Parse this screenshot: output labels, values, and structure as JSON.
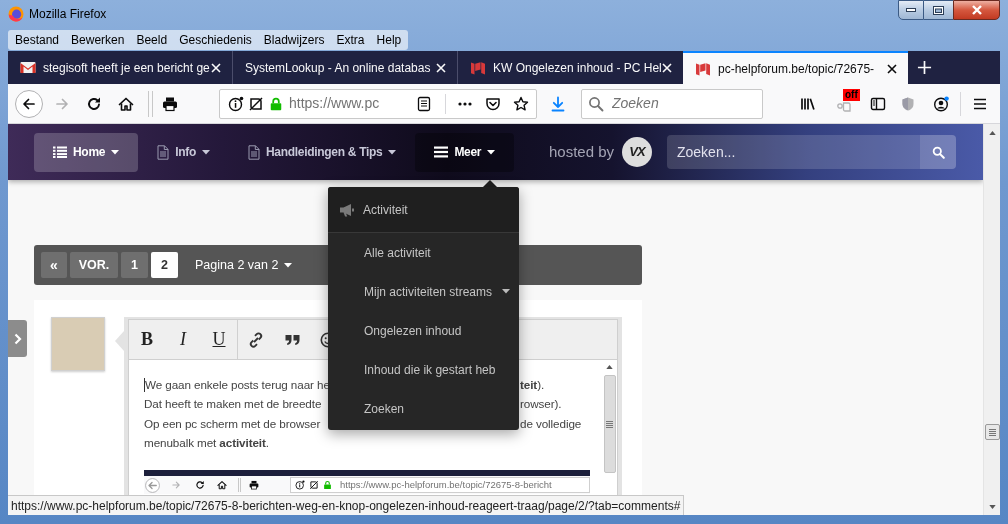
{
  "window": {
    "title": "Mozilla Firefox"
  },
  "menu_bar": [
    "Bestand",
    "Bewerken",
    "Beeld",
    "Geschiedenis",
    "Bladwijzers",
    "Extra",
    "Help"
  ],
  "tabs": [
    {
      "label": "stegisoft heeft je een bericht ge",
      "kind": "mail",
      "selected": false
    },
    {
      "label": "SystemLookup - An online databas",
      "kind": "plain",
      "selected": false
    },
    {
      "label": "KW Ongelezen inhoud - PC Hel",
      "kind": "forum",
      "selected": false
    },
    {
      "label": "pc-helpforum.be/topic/72675-",
      "kind": "forum",
      "selected": true
    }
  ],
  "toolbar": {
    "url": "https://www.pc",
    "search_placeholder": "Zoeken",
    "extension_badge": "off"
  },
  "forum_nav": {
    "items": [
      {
        "label": "Home",
        "kind": "list",
        "selected": true,
        "expanded": false
      },
      {
        "label": "Info",
        "kind": "document",
        "selected": false,
        "expanded": false
      },
      {
        "label": "Handleidingen & Tips",
        "kind": "document",
        "selected": false,
        "expanded": false
      },
      {
        "label": "Meer",
        "kind": "bars",
        "selected": false,
        "expanded": true
      }
    ],
    "hosted_by": "hosted by",
    "logo": "VX",
    "search_placeholder": "Zoeken..."
  },
  "dropdown": {
    "header": "Activiteit",
    "items": [
      {
        "label": "Alle activiteit",
        "kind": "link"
      },
      {
        "label": "Mijn activiteiten streams",
        "kind": "submenu"
      },
      {
        "label": "Ongelezen inhoud",
        "kind": "link"
      },
      {
        "label": "Inhoud die ik gestart heb",
        "kind": "link"
      },
      {
        "label": "Zoeken",
        "kind": "link"
      }
    ]
  },
  "pagination": {
    "first": "«",
    "previous": "VOR.",
    "pages": [
      {
        "label": "1",
        "selected": false
      },
      {
        "label": "2",
        "selected": true
      }
    ],
    "page_menu": "Pagina 2 van 2"
  },
  "editor": {
    "format_buttons": [
      {
        "label": "B",
        "kind": "bold"
      },
      {
        "label": "I",
        "kind": "italic"
      },
      {
        "label": "U",
        "kind": "underline"
      }
    ],
    "lines": [
      {
        "start": "We gaan enkele posts terug naar he",
        "end": "**teit**).",
        "caret": true
      },
      {
        "start": "Dat heeft te maken met de breedte",
        "end": "rowser).",
        "caret": false
      },
      {
        "start": "Op een pc scherm met de browser",
        "end": "de volledige",
        "caret": false
      },
      {
        "start": "menubalk met **activiteit**.",
        "caret": false
      }
    ],
    "embedded_screenshot": {
      "url": "https://www.pc-helpforum.be/topic/72675-8-bericht"
    }
  },
  "status_bar": "https://www.pc-helpforum.be/topic/72675-8-berichten-weg-en-knop-ongelezen-inhoud-reageert-traag/page/2/?tab=comments#"
}
